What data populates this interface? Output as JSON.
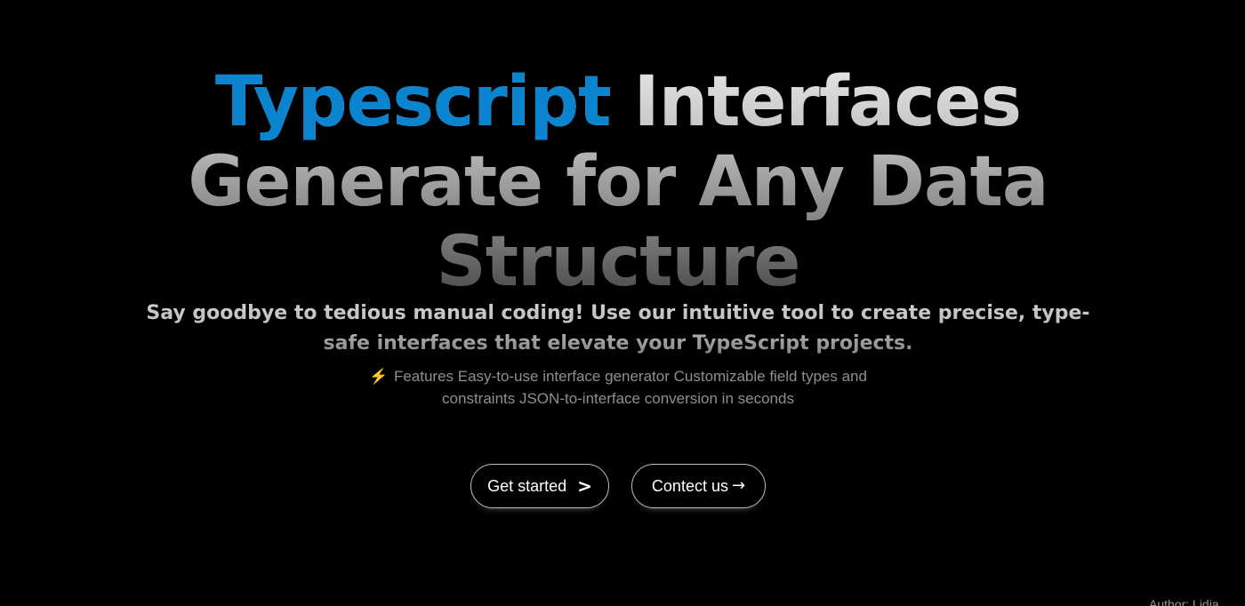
{
  "hero": {
    "headline_accent": "Typescript",
    "headline_rest": " Interfaces Generate for Any Data Structure",
    "tagline": "Say goodbye to tedious manual coding! Use our intuitive tool to create precise, type-safe interfaces that elevate your TypeScript projects.",
    "features_icon": "⚡",
    "features_text": "Features Easy-to-use interface generator Customizable field types and constraints JSON-to-interface conversion in seconds"
  },
  "actions": {
    "get_started_label": "Get started",
    "get_started_icon": ">",
    "contact_label": "Contect us",
    "contact_icon": "→"
  },
  "footer": {
    "fragment_text": "Author: Lidia"
  },
  "colors": {
    "accent": "#0a84cf",
    "background": "#000000",
    "bolt": "#f5c518"
  }
}
